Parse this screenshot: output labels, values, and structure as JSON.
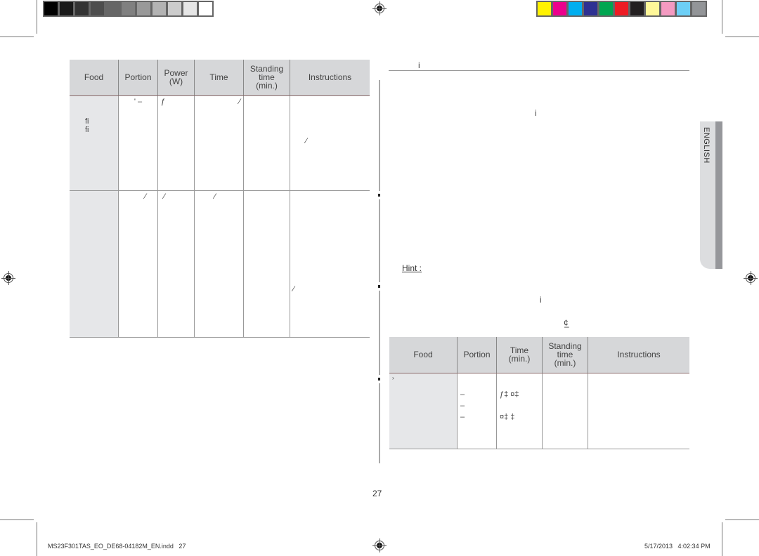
{
  "print_marks": {
    "gray_swatches": [
      "#000000",
      "#1a1a1a",
      "#333333",
      "#4d4d4d",
      "#666666",
      "#808080",
      "#999999",
      "#b3b3b3",
      "#cccccc",
      "#e6e6e6",
      "#ffffff"
    ],
    "color_swatches": [
      "#fff200",
      "#ec008c",
      "#00aeef",
      "#2e3192",
      "#00a651",
      "#ed1c24",
      "#231f20",
      "#fff799",
      "#f49ac1",
      "#6dcff6",
      "#939598"
    ]
  },
  "left_table": {
    "headers": [
      "Food",
      "Portion",
      "Power\n(W)",
      "Time",
      "Standing\ntime\n(min.)",
      "Instructions"
    ],
    "rows": [
      {
        "food": "fi\nfi",
        "portion": "' –",
        "power": "ƒ",
        "time": "⁄",
        "standing": "",
        "instructions": "⁄"
      },
      {
        "food": "",
        "portion": "⁄",
        "power": "⁄",
        "time": "⁄",
        "standing": "",
        "instructions": "⁄"
      }
    ]
  },
  "right_column": {
    "heading_glyph": "i",
    "body_glyph": "i",
    "hint_label": "Hint :",
    "hint_glyphs": [
      "i",
      "¢",
      "–"
    ]
  },
  "right_table": {
    "headers": [
      "Food",
      "Portion",
      "Time\n(min.)",
      "Standing\ntime\n(min.)",
      "Instructions"
    ],
    "rows": [
      {
        "food": "›",
        "portion": "–\n–\n–",
        "time": "ƒ‡ ¤‡\n\n¤‡ ‡",
        "standing": "",
        "instructions": ""
      }
    ]
  },
  "language_tab": "ENGLISH",
  "page_number": "27",
  "footer": {
    "file": "MS23F301TAS_EO_DE68-04182M_EN.indd   27",
    "timestamp": "5/17/2013   4:02:34 PM"
  }
}
